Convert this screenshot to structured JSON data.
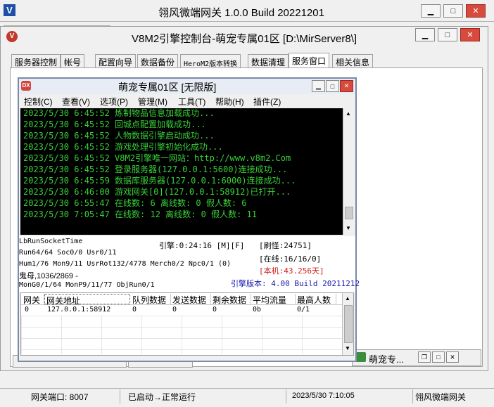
{
  "outer_window": {
    "title": "翎风微端网关 1.0.0 Build 20221201",
    "icon": "V"
  },
  "console_window": {
    "title": "V8M2引擎控制台-萌宠专属01区 [D:\\MirServer8\\]",
    "tabs": [
      "服务器控制",
      "帐号",
      "配置向导",
      "数据备份",
      "HeroM2版本转换",
      "数据清理",
      "服务窗口",
      "相关信息"
    ],
    "active_tab": "服务窗口"
  },
  "inner_window": {
    "title": "萌宠专属01区 [无限版]",
    "menu": [
      "控制(C)",
      "查看(V)",
      "选项(P)",
      "管理(M)",
      "工具(T)",
      "帮助(H)",
      "插件(Z)"
    ],
    "log": [
      "2023/5/30 6:45:52 炼制物品信息加载成功...",
      "2023/5/30 6:45:52 回城点配置加载成功...",
      "2023/5/30 6:45:52 人物数据引擎启动成功...",
      "2023/5/30 6:45:52 游戏处理引擎初始化成功...",
      "2023/5/30 6:45:52 V8M2引擎唯一网站：http://www.v8m2.Com",
      "2023/5/30 6:45:52 登录服务器(127.0.0.1:5600)连接成功...",
      "2023/5/30 6:45:59 数据库服务器(127.0.0.1:6000)连接成功...",
      "2023/5/30 6:46:00 游戏网关[0](127.0.0.1:58912)已打开...",
      "2023/5/30 6:55:47 在线数: 6 离线数: 0 假人数: 6",
      "2023/5/30 7:05:47 在线数: 12 离线数: 0 假人数: 11"
    ],
    "stats": {
      "line1": "LbRunSocketTime",
      "line2": "Run64/64 Soc0/0 Usr0/11",
      "line3": "Hum1/76 Mon9/11 UsrRot132/4778 Merch0/2 Npc0/1 (0)",
      "line4": "鬼母,1036/2869 -",
      "line5": "MonG0/1/64 MonP9/11/77 ObjRun0/1",
      "engine_time": "引擎:0:24:16 [M][F]",
      "monsters": "[刷怪:24751]",
      "online": "[在线:16/16/0]",
      "local": "[本机:43.256天]",
      "version": "引擎版本: 4.00 Build 20211212"
    },
    "table": {
      "headers": [
        "网关",
        "网关地址",
        "队列数据",
        "发送数据",
        "剩余数据",
        "平均流量",
        "最高人数"
      ],
      "rows": [
        [
          "0",
          "127.0.0.1:58912",
          "0",
          "0",
          "0",
          "0b",
          "0/1"
        ]
      ]
    }
  },
  "taskbar_fragment": {
    "label": "萌宠专..."
  },
  "status_bar": {
    "port": "网关端口: 8007",
    "state": "已启动→正常运行",
    "datetime": "2023/5/30  7:10:05",
    "name": "翎风微端网关"
  },
  "colors": {
    "log_text": "#38d038",
    "log_bg": "#000000",
    "version_text": "#1a1ab0",
    "local_text": "#d02020",
    "close_button": "#d84a3e"
  }
}
